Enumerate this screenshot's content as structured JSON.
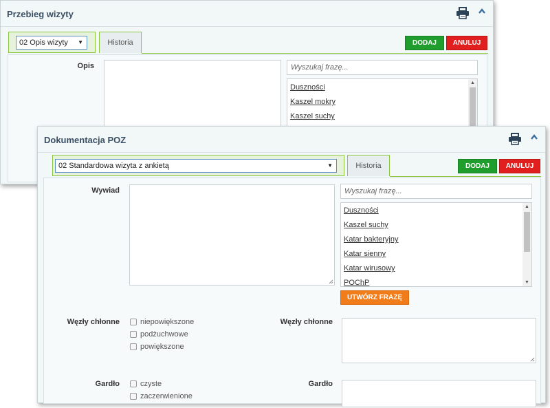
{
  "back_window": {
    "title": "Przebieg wizyty",
    "select_value": "02 Opis wizyty",
    "tab_history": "Historia",
    "add_button": "DODAJ",
    "cancel_button": "ANULUJ",
    "field_label": "Opis",
    "search_placeholder": "Wyszukaj frazę...",
    "phrases": [
      "Duszności",
      "Kaszel mokry",
      "Kaszel suchy"
    ]
  },
  "front_window": {
    "title": "Dokumentacja POZ",
    "select_value": "02 Standardowa wizyta z ankietą",
    "tab_history": "Historia",
    "add_button": "DODAJ",
    "cancel_button": "ANULUJ",
    "interview_label": "Wywiad",
    "search_placeholder": "Wyszukaj frazę...",
    "phrases": [
      "Duszności",
      "Kaszel suchy",
      "Katar bakteryjny",
      "Katar sienny",
      "Katar wirusowy",
      "POChP"
    ],
    "create_phrase_button": "UTWÓRZ FRAZĘ",
    "lymph_nodes": {
      "label": "Węzły chłonne",
      "options": [
        "niepowiększone",
        "podżuchwowe",
        "powiększone"
      ],
      "notes_label": "Węzły chłonne"
    },
    "throat": {
      "label": "Gardło",
      "options": [
        "czyste",
        "zaczerwienione"
      ],
      "notes_label": "Gardło"
    }
  },
  "colors": {
    "green_button": "#1f9d2d",
    "red_button": "#e21f1f",
    "orange_button": "#f07c1a",
    "title_text": "#3a4f63",
    "tab_border": "#8cc63f"
  },
  "icons": {
    "print": "printer-icon",
    "collapse": "chevron-up-icon"
  }
}
